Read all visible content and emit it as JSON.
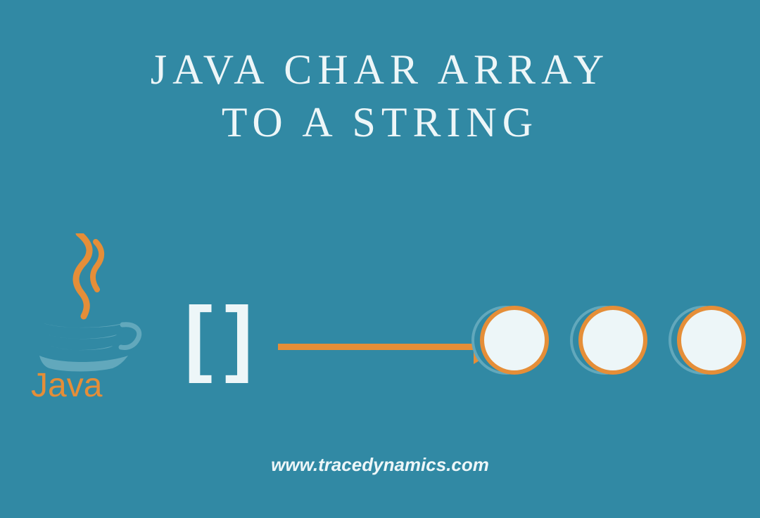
{
  "title": {
    "line1": "JAVA CHAR ARRAY",
    "line2": "TO A STRING"
  },
  "brackets": "[ ]",
  "logo_text": "Java",
  "website": "www.tracedynamics.com",
  "colors": {
    "background": "#3189a4",
    "accent": "#e58e38",
    "light": "#edf6f8"
  }
}
